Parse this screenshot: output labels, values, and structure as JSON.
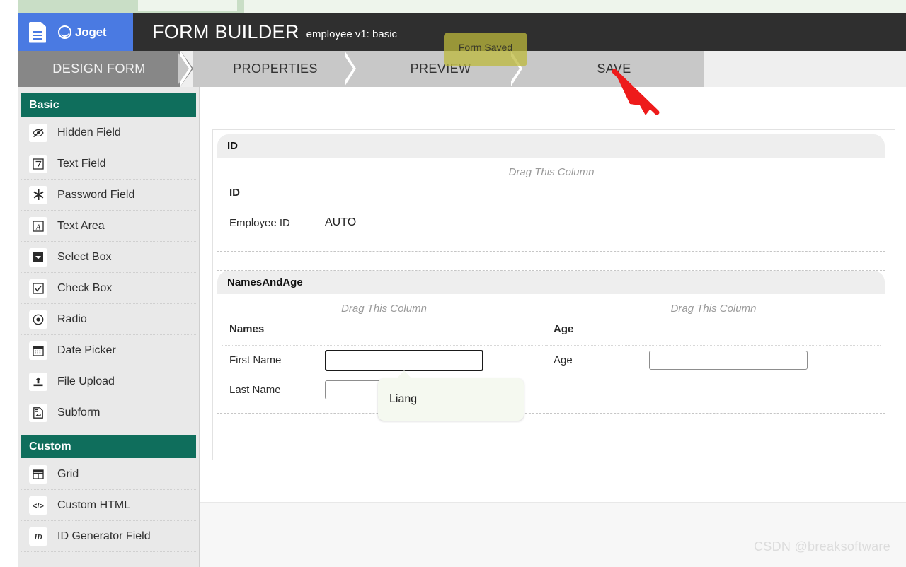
{
  "browser": {
    "tab_strip_color": "#c9dec6"
  },
  "header": {
    "app_brand": "Joget",
    "title": "FORM BUILDER",
    "subtitle": "employee v1: basic",
    "logo_icon": "document-icon",
    "brand_icon": "joget-logo-icon",
    "background": "#2f2f2f",
    "logo_background": "#4a7ae2"
  },
  "toast": {
    "message": "Form Saved",
    "color": "#bdb83c"
  },
  "tabs": [
    {
      "label": "DESIGN FORM",
      "active": true
    },
    {
      "label": "PROPERTIES",
      "active": false
    },
    {
      "label": "PREVIEW",
      "active": false
    },
    {
      "label": "SAVE",
      "active": false
    }
  ],
  "annotation": {
    "arrow": "red-arrow-pointing-to-save",
    "color": "#ee1b1b"
  },
  "sidebar": {
    "groups": [
      {
        "title": "Basic",
        "items": [
          {
            "label": "Hidden Field",
            "icon": "eye-slash-icon"
          },
          {
            "label": "Text Field",
            "icon": "text-field-icon"
          },
          {
            "label": "Password Field",
            "icon": "asterisk-icon"
          },
          {
            "label": "Text Area",
            "icon": "text-area-icon"
          },
          {
            "label": "Select Box",
            "icon": "caret-down-box-icon"
          },
          {
            "label": "Check Box",
            "icon": "check-square-icon"
          },
          {
            "label": "Radio",
            "icon": "radio-circle-icon"
          },
          {
            "label": "Date Picker",
            "icon": "calendar-icon"
          },
          {
            "label": "File Upload",
            "icon": "upload-icon"
          },
          {
            "label": "Subform",
            "icon": "subform-icon"
          }
        ]
      },
      {
        "title": "Custom",
        "items": [
          {
            "label": "Grid",
            "icon": "grid-icon"
          },
          {
            "label": "Custom HTML",
            "icon": "code-icon"
          },
          {
            "label": "ID Generator Field",
            "icon": "id-icon"
          }
        ]
      }
    ],
    "header_color": "#0f6e5c"
  },
  "canvas": {
    "sections": [
      {
        "title": "ID",
        "columns": [
          {
            "hint": "Drag This Column",
            "name": "ID",
            "fields": [
              {
                "label": "Employee ID",
                "value": "AUTO",
                "type": "static"
              }
            ]
          }
        ]
      },
      {
        "title": "NamesAndAge",
        "columns": [
          {
            "hint": "Drag This Column",
            "name": "Names",
            "fields": [
              {
                "label": "First Name",
                "value": "",
                "type": "input",
                "focused": true
              },
              {
                "label": "Last Name",
                "value": "",
                "type": "input",
                "focused": false
              }
            ]
          },
          {
            "hint": "Drag This Column",
            "name": "Age",
            "fields": [
              {
                "label": "Age",
                "value": "",
                "type": "input",
                "focused": false
              }
            ]
          }
        ]
      }
    ],
    "suggestion": {
      "text": "Liang"
    }
  },
  "footer": {
    "watermark": "CSDN @breaksoftware"
  }
}
